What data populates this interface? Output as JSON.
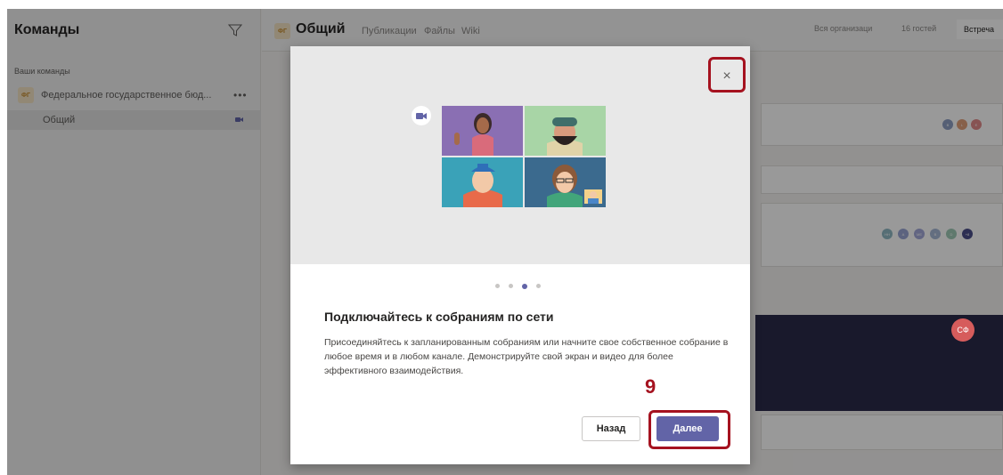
{
  "sidebar": {
    "title": "Команды",
    "section_label": "Ваши команды",
    "team": {
      "avatar": "ФГ",
      "name": "Федеральное государственное бюд...",
      "more": "•••"
    },
    "channel": {
      "name": "Общий"
    }
  },
  "header": {
    "avatar": "ФГ",
    "channel_title": "Общий",
    "tabs": [
      "Публикации",
      "Файлы",
      "Wiki"
    ],
    "org_label": "Вся организаци",
    "guests_label": "16 гостей",
    "meet_label": "Встреча"
  },
  "background": {
    "avatars_row1": [
      "В",
      "L",
      "Е"
    ],
    "avatars_row2": [
      "НН",
      "А",
      "МЕ",
      "В",
      "D",
      "+8"
    ],
    "card_avatar": "СФ"
  },
  "dialog": {
    "close_label": "×",
    "title": "Подключайтесь к собраниям по сети",
    "body": "Присоединяйтесь к запланированным собраниям или начните свое собственное собрание в любое время и в любом канале. Демонстрируйте свой экран и видео для более эффективного взаимодействия.",
    "pager": {
      "total": 4,
      "active": 3
    },
    "back_button": "Назад",
    "next_button": "Далее"
  },
  "annotation": {
    "step": "9",
    "color": "#a5121f"
  },
  "colors": {
    "accent": "#6264a7",
    "overlay": "rgba(0,0,0,0.4)"
  }
}
